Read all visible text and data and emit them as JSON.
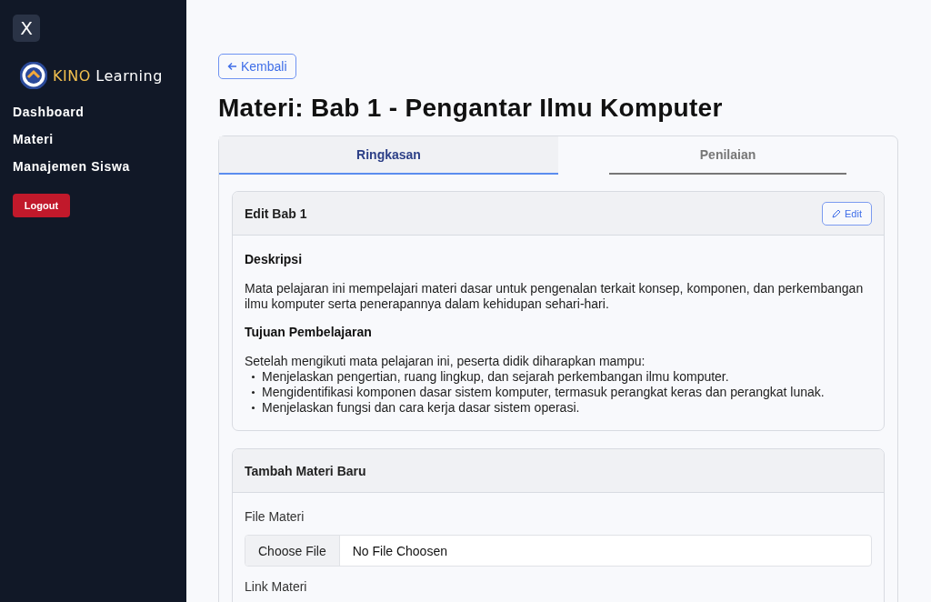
{
  "sidebar": {
    "close_label": "X",
    "logo": {
      "accent": "KINO",
      "text": "Learning"
    },
    "items": [
      {
        "label": "Dashboard"
      },
      {
        "label": "Materi"
      },
      {
        "label": "Manajemen Siswa"
      }
    ],
    "logout": "Logout"
  },
  "back_button": "Kembali",
  "title": "Materi: Bab 1 - Pengantar Ilmu Komputer",
  "tabs": [
    {
      "label": "Ringkasan",
      "selected": true
    },
    {
      "label": "Penilaian",
      "selected": false
    }
  ],
  "chapter_card": {
    "title": "Edit Bab 1",
    "edit_button": "Edit",
    "sections": [
      {
        "heading": "Deskripsi",
        "text": "Mata pelajaran ini mempelajari materi dasar untuk pengenalan terkait konsep, komponen, dan perkembangan ilmu komputer serta penerapannya dalam kehidupan sehari-hari."
      },
      {
        "heading": "Tujuan Pembelajaran",
        "text": "Setelah mengikuti mata pelajaran ini, peserta didik diharapkan mampu:",
        "bullets": [
          "Menjelaskan pengertian, ruang lingkup, dan sejarah perkembangan ilmu komputer.",
          "Mengidentifikasi komponen dasar sistem komputer, termasuk perangkat keras dan perangkat lunak.",
          "Menjelaskan fungsi dan cara kerja dasar sistem operasi."
        ]
      }
    ]
  },
  "add_card": {
    "title": "Tambah Materi Baru",
    "fields": [
      {
        "kind": "file",
        "label": "File Materi",
        "button": "Choose File",
        "value": "No File Choosen"
      },
      {
        "kind": "text",
        "label": "Link Materi"
      }
    ]
  }
}
